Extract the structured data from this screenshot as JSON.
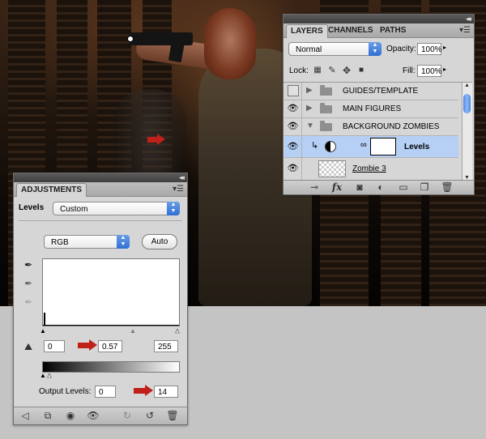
{
  "layers_panel": {
    "tabs": [
      {
        "label": "LAYERS",
        "active": true
      },
      {
        "label": "CHANNELS",
        "active": false
      },
      {
        "label": "PATHS",
        "active": false
      }
    ],
    "blend_mode": "Normal",
    "opacity_label": "Opacity:",
    "opacity_value": "100%",
    "lock_label": "Lock:",
    "fill_label": "Fill:",
    "fill_value": "100%",
    "layers": [
      {
        "name": "GUIDES/TEMPLATE",
        "visible": false,
        "expanded": false,
        "type": "group"
      },
      {
        "name": "MAIN FIGURES",
        "visible": true,
        "expanded": false,
        "type": "group"
      },
      {
        "name": "BACKGROUND ZOMBIES",
        "visible": true,
        "expanded": true,
        "type": "group"
      },
      {
        "name": "Levels",
        "visible": true,
        "type": "adjustment",
        "selected": true
      },
      {
        "name": "Zombie 3",
        "visible": true,
        "type": "pixel"
      }
    ],
    "footer_icons": [
      "link-icon",
      "fx-icon",
      "mask-icon",
      "adjustment-icon",
      "folder-icon",
      "new-layer-icon",
      "trash-icon"
    ]
  },
  "adjustments_panel": {
    "tab": "ADJUSTMENTS",
    "preset_label": "Levels",
    "preset_value": "Custom",
    "channel_value": "RGB",
    "auto_label": "Auto",
    "input_black": "0",
    "input_gamma": "0.57",
    "input_white": "255",
    "output_label": "Output Levels:",
    "output_black": "0",
    "output_white": "14",
    "footer_icons": [
      "back-icon",
      "expand-view-icon",
      "clip-icon",
      "visibility-icon",
      "reset-icon",
      "previous-state-icon",
      "trash-icon"
    ]
  },
  "colors": {
    "annotation_arrow": "#c0201a",
    "selection": "#b5cff5",
    "accent_blue": "#2f6fd4"
  }
}
